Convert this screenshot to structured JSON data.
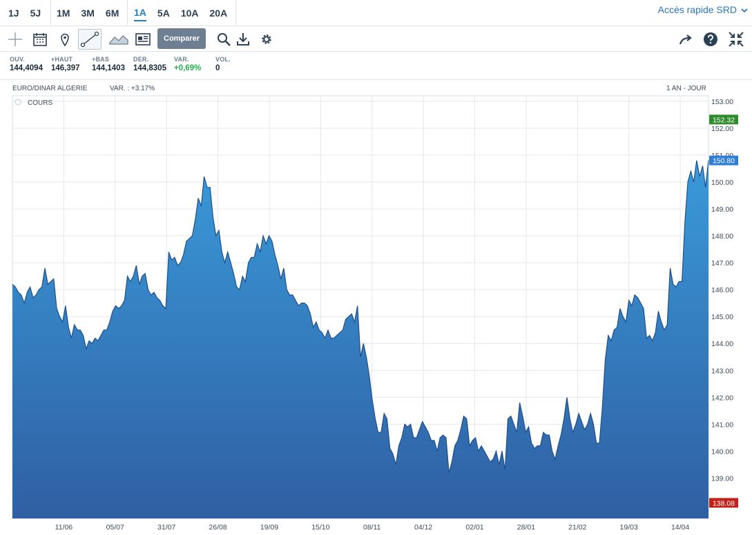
{
  "periods": [
    "1J",
    "5J",
    "1M",
    "3M",
    "6M",
    "1A",
    "5A",
    "10A",
    "20A"
  ],
  "active_period": "1A",
  "quick_access": "Accès rapide SRD",
  "toolbar": {
    "compare_label": "Comparer"
  },
  "stats": [
    {
      "label": "OUV.",
      "value": "144,4094"
    },
    {
      "label": "+HAUT",
      "value": "146,397"
    },
    {
      "label": "+BAS",
      "value": "144,1403"
    },
    {
      "label": "DER.",
      "value": "144,8305"
    },
    {
      "label": "VAR.",
      "value": "+0,69%"
    },
    {
      "label": "VOL.",
      "value": "0"
    }
  ],
  "chart_header": {
    "instrument": "EURO/DINAR ALGERIE",
    "variation": "VAR. : +3.17%",
    "range": "1 AN - JOUR"
  },
  "legend_label": "COURS",
  "colors": {
    "area_top": "#3a9ad9",
    "area_bottom": "#2f5fa3",
    "line": "#1d4f8c",
    "high_badge": "#2e8b2e",
    "last_badge": "#2f7fd6",
    "low_badge": "#c0221b",
    "accent": "#1f7fc9"
  },
  "chart_data": {
    "type": "area",
    "title": "EURO/DINAR ALGERIE",
    "ylim": [
      137.5,
      153.2
    ],
    "yticks": [
      153,
      152,
      151,
      150,
      149,
      148,
      147,
      146,
      145,
      144,
      143,
      142,
      141,
      140,
      139
    ],
    "xtick_labels": [
      "11/06",
      "05/07",
      "31/07",
      "26/08",
      "19/09",
      "15/10",
      "08/11",
      "04/12",
      "02/01",
      "28/01",
      "21/02",
      "19/03",
      "14/04"
    ],
    "grid": true,
    "badges": {
      "high": "152.32",
      "last": "150.80",
      "low": "138.08"
    },
    "series": [
      {
        "values": [
          146.2,
          146.1,
          145.9,
          145.8,
          145.5,
          145.9,
          146.1,
          145.7,
          145.8,
          146.0,
          146.1,
          146.8,
          146.2,
          146.3,
          146.4,
          145.3,
          145.0,
          144.8,
          145.4,
          144.6,
          144.2,
          144.7,
          144.5,
          144.5,
          144.3,
          143.8,
          144.1,
          144.0,
          144.2,
          144.1,
          144.3,
          144.5,
          144.5,
          144.8,
          145.2,
          145.4,
          145.3,
          145.4,
          145.6,
          146.5,
          146.3,
          146.5,
          146.9,
          146.2,
          146.5,
          146.6,
          146.0,
          145.8,
          145.9,
          145.7,
          145.6,
          145.4,
          145.3,
          147.4,
          147.1,
          147.2,
          146.9,
          147.0,
          147.3,
          147.8,
          147.9,
          148.0,
          148.6,
          149.4,
          149.1,
          150.2,
          149.8,
          149.8,
          148.7,
          148.0,
          148.2,
          147.4,
          147.0,
          147.4,
          147.0,
          146.6,
          146.1,
          146.0,
          146.5,
          146.3,
          147.0,
          147.2,
          147.2,
          147.7,
          147.4,
          148.0,
          147.7,
          148.0,
          147.8,
          147.3,
          146.9,
          146.4,
          146.8,
          146.0,
          145.8,
          145.8,
          145.6,
          145.4,
          145.5,
          145.5,
          145.4,
          145.1,
          144.6,
          144.8,
          144.5,
          144.4,
          144.2,
          144.5,
          144.2,
          144.2,
          144.3,
          144.4,
          144.5,
          144.9,
          145.0,
          145.1,
          144.8,
          145.4,
          143.5,
          144.0,
          143.5,
          142.8,
          141.9,
          141.2,
          140.7,
          140.7,
          141.4,
          141.2,
          140.1,
          139.9,
          139.5,
          140.2,
          140.5,
          141.0,
          140.9,
          141.0,
          140.5,
          140.5,
          140.8,
          141.1,
          140.9,
          140.7,
          140.4,
          140.4,
          140.0,
          140.5,
          140.6,
          140.5,
          139.2,
          139.6,
          140.2,
          140.4,
          140.8,
          141.3,
          141.2,
          140.2,
          140.4,
          140.5,
          140.0,
          140.2,
          140.0,
          139.8,
          139.6,
          139.7,
          140.0,
          139.5,
          140.0,
          139.3,
          141.2,
          141.3,
          141.0,
          140.7,
          141.8,
          141.3,
          140.7,
          140.9,
          140.3,
          140.1,
          140.2,
          140.2,
          140.7,
          140.6,
          140.6,
          140.0,
          139.7,
          140.2,
          140.6,
          141.2,
          142.0,
          141.2,
          140.7,
          141.0,
          141.4,
          141.1,
          140.8,
          141.0,
          141.4,
          141.0,
          140.3,
          140.3,
          141.6,
          143.4,
          144.3,
          144.1,
          144.5,
          144.6,
          145.3,
          145.0,
          144.8,
          145.6,
          145.4,
          145.8,
          145.7,
          145.5,
          145.3,
          144.2,
          144.3,
          144.1,
          144.4,
          145.2,
          144.8,
          144.5,
          144.7,
          146.8,
          146.2,
          146.1,
          146.3,
          146.3,
          148.5,
          150.0,
          150.4,
          150.0,
          150.8,
          150.2,
          150.6,
          149.8,
          150.8
        ]
      }
    ]
  }
}
